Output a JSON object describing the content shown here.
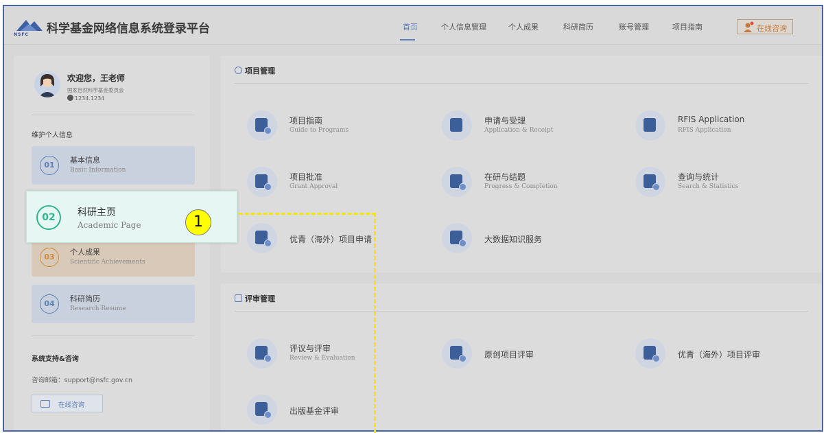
{
  "header": {
    "logo_text": "NSFC",
    "site_title": "科学基金网络信息系统登录平台",
    "nav": [
      "首页",
      "个人信息管理",
      "个人成果",
      "科研简历",
      "账号管理",
      "项目指南"
    ],
    "active_nav": "首页",
    "consult_label": "在线咨询"
  },
  "sidebar": {
    "welcome": "欢迎您，王老师",
    "org": "国家自然科学基金委员会",
    "user_id": "1234.1234",
    "section_label": "维护个人信息",
    "menu": [
      {
        "num": "01",
        "cn": "基本信息",
        "en": "Basic Information",
        "color": "#5b7fb8"
      },
      {
        "num": "02",
        "cn": "科研主页",
        "en": "Academic Page",
        "color": "#2fb58e"
      },
      {
        "num": "03",
        "cn": "个人成果",
        "en": "Scientific Achievements",
        "color": "#d08a3a"
      },
      {
        "num": "04",
        "cn": "科研简历",
        "en": "Research Resume",
        "color": "#5b7fb8"
      }
    ],
    "support_title": "系统支持&咨询",
    "support_email": "咨询邮箱：support@nsfc.gov.cn",
    "consult_label": "在线咨询"
  },
  "project_panel": {
    "title": "项目管理",
    "tiles": [
      {
        "cn": "项目指南",
        "en": "Guide to Programs",
        "icon": "map-icon"
      },
      {
        "cn": "申请与受理",
        "en": "Application & Receipt",
        "icon": "edit-icon"
      },
      {
        "cn": "RFIS Application",
        "en": "RFIS Application",
        "icon": "grid-icon"
      },
      {
        "cn": "项目批准",
        "en": "Grant Approval",
        "icon": "document-icon"
      },
      {
        "cn": "在研与结题",
        "en": "Progress & Completion",
        "icon": "list-icon"
      },
      {
        "cn": "查询与统计",
        "en": "Search & Statistics",
        "icon": "chart-icon"
      },
      {
        "cn": "优青（海外）项目申请",
        "en": "",
        "icon": "graduate-icon"
      },
      {
        "cn": "大数据知识服务",
        "en": "",
        "icon": "document-icon"
      }
    ]
  },
  "review_panel": {
    "title": "评审管理",
    "tiles": [
      {
        "cn": "评议与评审",
        "en": "Review & Evaluation",
        "icon": "review-icon"
      },
      {
        "cn": "原创项目评审",
        "en": "",
        "icon": "document-icon"
      },
      {
        "cn": "优青（海外）项目评审",
        "en": "",
        "icon": "document-icon"
      },
      {
        "cn": "出版基金评审",
        "en": "",
        "icon": "database-icon"
      }
    ]
  },
  "annotation": {
    "step_number": "1",
    "highlight_color": "#ffff00"
  }
}
